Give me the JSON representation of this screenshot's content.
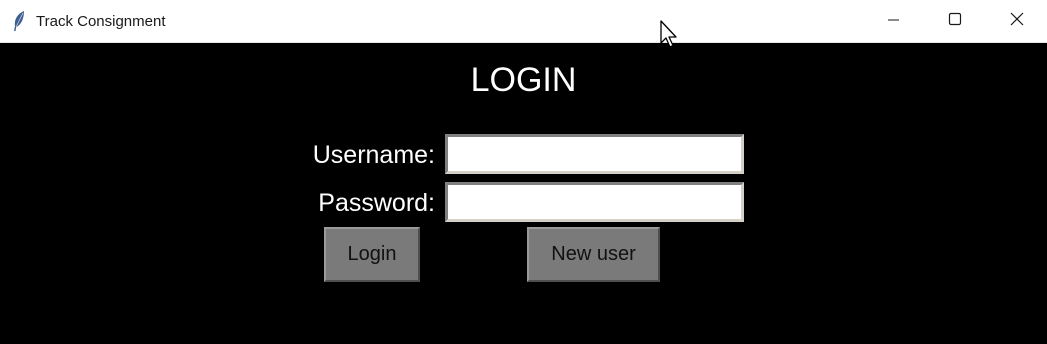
{
  "window": {
    "title": "Track Consignment",
    "icons": {
      "app": "feather-icon",
      "minimize": "minimize-icon",
      "maximize": "maximize-icon",
      "close": "close-icon"
    }
  },
  "form": {
    "heading": "LOGIN",
    "username_label": "Username:",
    "username_value": "",
    "password_label": "Password:",
    "password_value": "",
    "login_button": "Login",
    "new_user_button": "New user"
  },
  "colors": {
    "background": "#000000",
    "titlebar": "#ffffff",
    "text": "#ffffff",
    "button": "#7a7a7a"
  }
}
